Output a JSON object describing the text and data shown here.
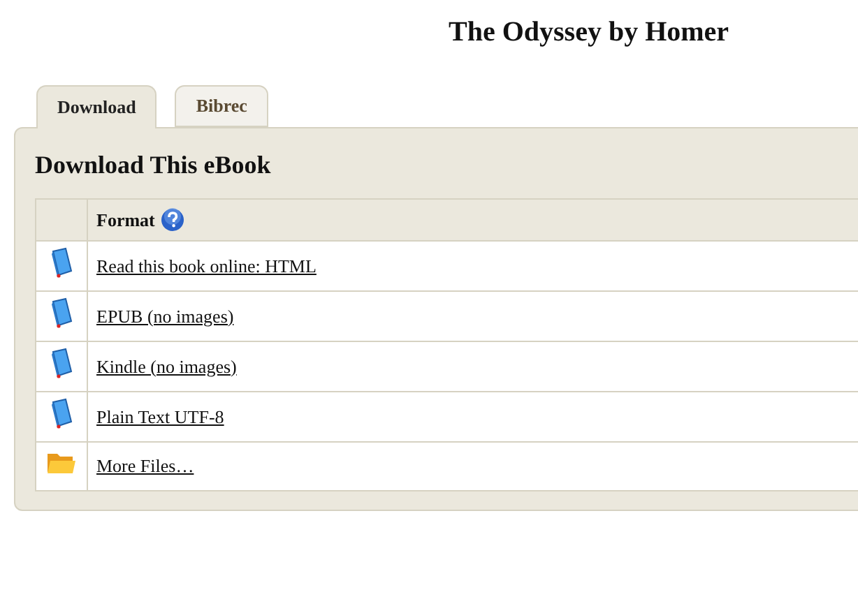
{
  "page_title": "The Odyssey by Homer",
  "tabs": [
    {
      "label": "Download",
      "selected": true
    },
    {
      "label": "Bibrec",
      "selected": false
    }
  ],
  "panel": {
    "heading": "Download This eBook",
    "table": {
      "columns": [
        "Format"
      ],
      "rows": [
        {
          "kind": "book",
          "link": "Read this book online: HTML"
        },
        {
          "kind": "book",
          "link": "EPUB (no images)"
        },
        {
          "kind": "book",
          "link": "Kindle (no images)"
        },
        {
          "kind": "book",
          "link": "Plain Text UTF-8"
        },
        {
          "kind": "folder",
          "link": "More Files…"
        }
      ]
    }
  }
}
